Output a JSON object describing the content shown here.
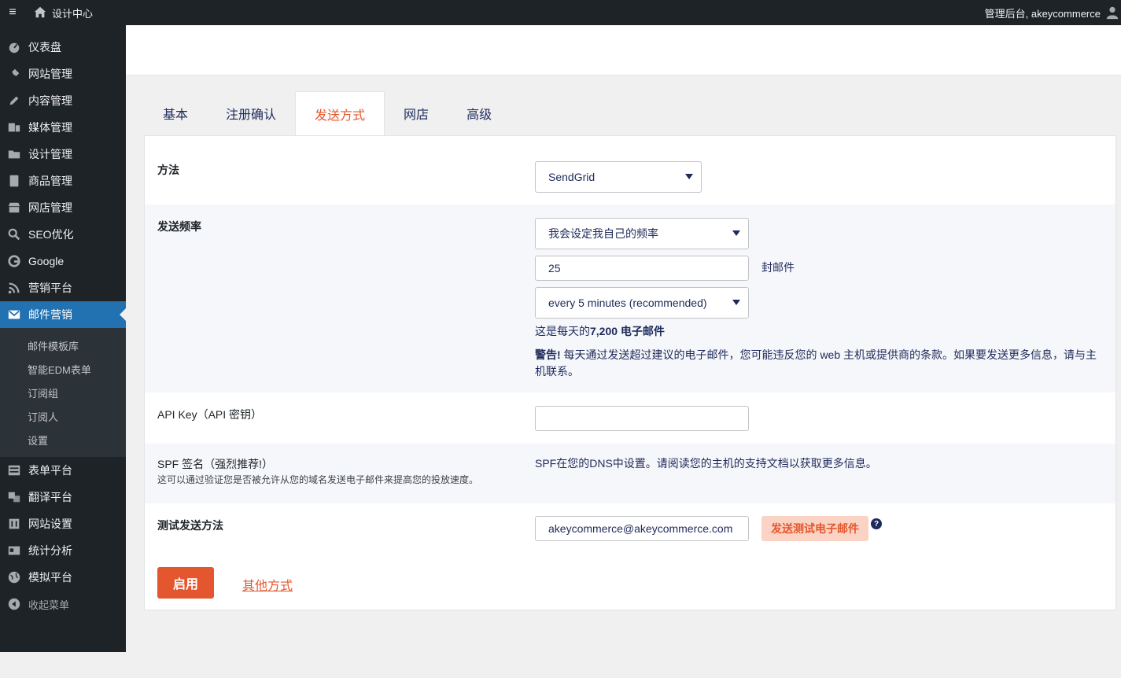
{
  "topbar": {
    "site_title": "设计中心",
    "user_greeting": "管理后台, akeycommerce"
  },
  "sidebar": {
    "items": [
      {
        "label": "仪表盘",
        "icon": "dashboard-icon"
      },
      {
        "label": "网站管理",
        "icon": "pin-icon"
      },
      {
        "label": "内容管理",
        "icon": "pencil-icon"
      },
      {
        "label": "媒体管理",
        "icon": "media-icon"
      },
      {
        "label": "设计管理",
        "icon": "folder-icon"
      },
      {
        "label": "商品管理",
        "icon": "book-icon"
      },
      {
        "label": "网店管理",
        "icon": "store-icon"
      },
      {
        "label": "SEO优化",
        "icon": "search-icon"
      },
      {
        "label": "Google",
        "icon": "google-icon"
      },
      {
        "label": "营销平台",
        "icon": "rss-icon"
      },
      {
        "label": "邮件营销",
        "icon": "email-icon"
      }
    ],
    "submenu": [
      "邮件模板库",
      "智能EDM表单",
      "订阅组",
      "订阅人",
      "设置"
    ],
    "items_after": [
      {
        "label": "表单平台",
        "icon": "form-icon"
      },
      {
        "label": "翻译平台",
        "icon": "translate-icon"
      },
      {
        "label": "网站设置",
        "icon": "settings-icon"
      },
      {
        "label": "统计分析",
        "icon": "analytics-icon"
      },
      {
        "label": "模拟平台",
        "icon": "globe-icon"
      }
    ],
    "collapse_label": "收起菜单"
  },
  "tabs": [
    "基本",
    "注册确认",
    "发送方式",
    "网店",
    "高级"
  ],
  "form": {
    "method": {
      "label": "方法",
      "value": "SendGrid"
    },
    "frequency": {
      "label": "发送频率",
      "mode_value": "我会设定我自己的频率",
      "count_value": "25",
      "count_unit": "封邮件",
      "interval_value": "every 5 minutes (recommended)",
      "per_day_prefix": "这是每天的",
      "per_day_bold": "7,200 电子邮件",
      "warning_bold": "警告!",
      "warning_text": " 每天通过发送超过建议的电子邮件，您可能违反您的 web 主机或提供商的条款。如果要发送更多信息，请与主机联系。"
    },
    "api_key": {
      "label": "API Key（API 密钥）",
      "value": ""
    },
    "spf": {
      "label": "SPF 签名（强烈推荐!）",
      "description": "这可以通过验证您是否被允许从您的域名发送电子邮件来提高您的投放速度。",
      "info": "SPF在您的DNS中设置。请阅读您的主机的支持文档以获取更多信息。"
    },
    "test": {
      "label": "测试发送方法",
      "email_value": "akeycommerce@akeycommerce.com",
      "button_label": "发送测试电子邮件",
      "help": "?"
    }
  },
  "actions": {
    "primary_label": "启用",
    "secondary_label": "其他方式"
  },
  "colors": {
    "accent": "#e4572e",
    "sidebar_bg": "#1d2327",
    "active_blue": "#2271b1"
  }
}
